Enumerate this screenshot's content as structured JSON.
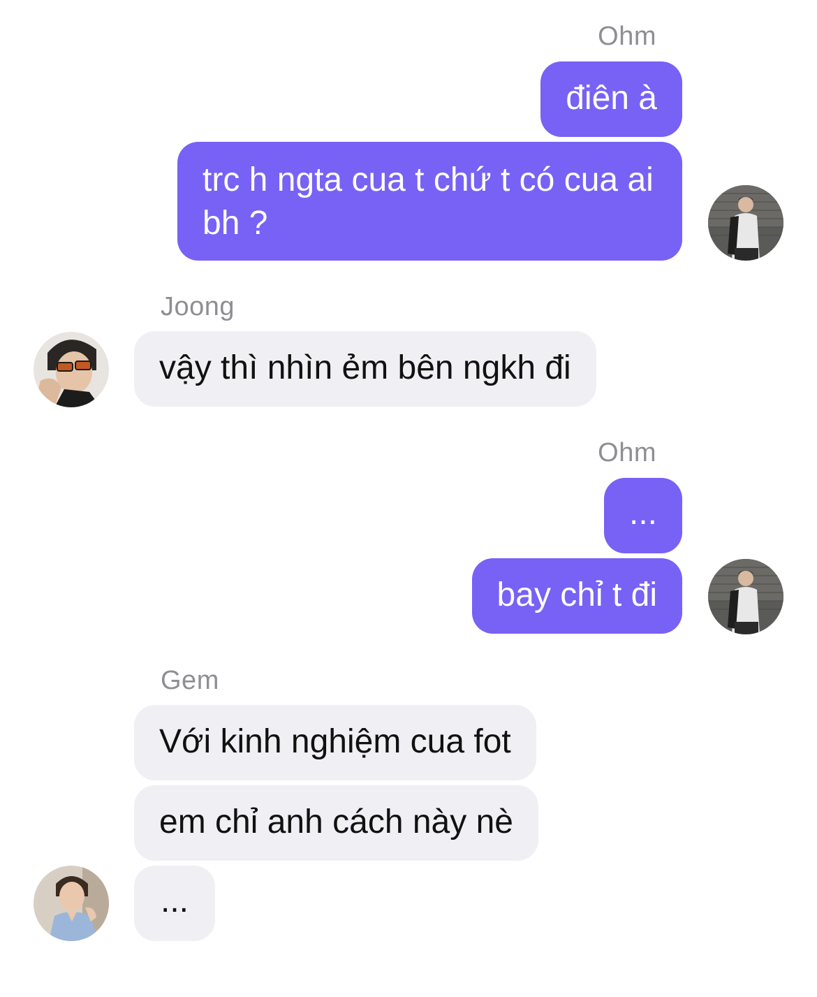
{
  "messages": {
    "g1": {
      "sender": "Ohm",
      "bubble1": "điên à",
      "bubble2": "trc h ngta cua t chứ t có cua ai bh ?"
    },
    "g2": {
      "sender": "Joong",
      "bubble1": "vậy thì nhìn ẻm bên ngkh đi"
    },
    "g3": {
      "sender": "Ohm",
      "bubble1": "...",
      "bubble2": "bay chỉ t đi"
    },
    "g4": {
      "sender": "Gem",
      "bubble1": "Với kinh nghiệm cua fot",
      "bubble2": "em chỉ anh cách này nè",
      "bubble3": "..."
    }
  },
  "colors": {
    "outgoing_bubble": "#7861f5",
    "incoming_bubble": "#efeff4",
    "sender_name": "#8e8e93"
  },
  "icons": {
    "ohm_avatar": "avatar-ohm-photo",
    "joong_avatar": "avatar-joong-photo",
    "gem_avatar": "avatar-gem-photo"
  }
}
